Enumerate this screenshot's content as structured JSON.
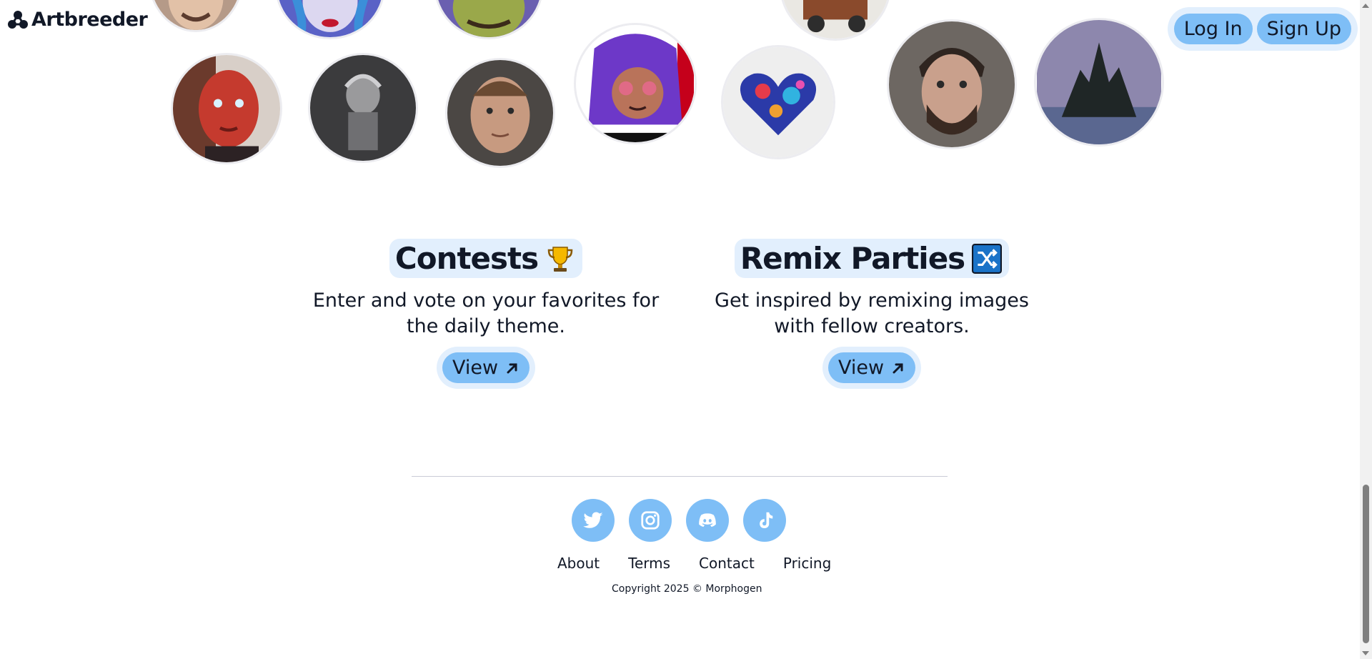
{
  "brand": {
    "name": "Artbreeder",
    "logo_icon": "triangle-dots-logo"
  },
  "auth": {
    "login_label": "Log In",
    "signup_label": "Sign Up"
  },
  "gallery": {
    "avatars": [
      {
        "id": "avatar-1",
        "subject": "smiling man portrait"
      },
      {
        "id": "avatar-2",
        "subject": "blue-haired woman"
      },
      {
        "id": "avatar-3",
        "subject": "green goblin face"
      },
      {
        "id": "avatar-4",
        "subject": "cart illustration"
      },
      {
        "id": "avatar-5",
        "subject": "red-skinned woman"
      },
      {
        "id": "avatar-6",
        "subject": "grey sketch figure"
      },
      {
        "id": "avatar-7",
        "subject": "young man portrait"
      },
      {
        "id": "avatar-8",
        "subject": "purple-haired anime girl"
      },
      {
        "id": "avatar-9",
        "subject": "colorful heart"
      },
      {
        "id": "avatar-10",
        "subject": "bearded man portrait"
      },
      {
        "id": "avatar-11",
        "subject": "dark castle landscape"
      }
    ]
  },
  "features": {
    "contests": {
      "title": "Contests",
      "emoji": "trophy-icon",
      "desc_line1": "Enter and vote on your favorites for",
      "desc_line2": "the daily theme.",
      "button_label": "View"
    },
    "remix": {
      "title": "Remix Parties",
      "emoji": "shuffle-icon",
      "desc_line1": "Get inspired by remixing images",
      "desc_line2": "with fellow creators.",
      "button_label": "View"
    }
  },
  "footer": {
    "social": [
      "twitter-icon",
      "instagram-icon",
      "discord-icon",
      "tiktok-icon"
    ],
    "links": {
      "about": "About",
      "terms": "Terms",
      "contact": "Contact",
      "pricing": "Pricing"
    },
    "copyright_prefix": "Copyright 2025 ©",
    "copyright_brand": "Morphogen"
  },
  "colors": {
    "accent": "#7ebef6",
    "accent_light": "#e2effd",
    "text": "#111827"
  }
}
